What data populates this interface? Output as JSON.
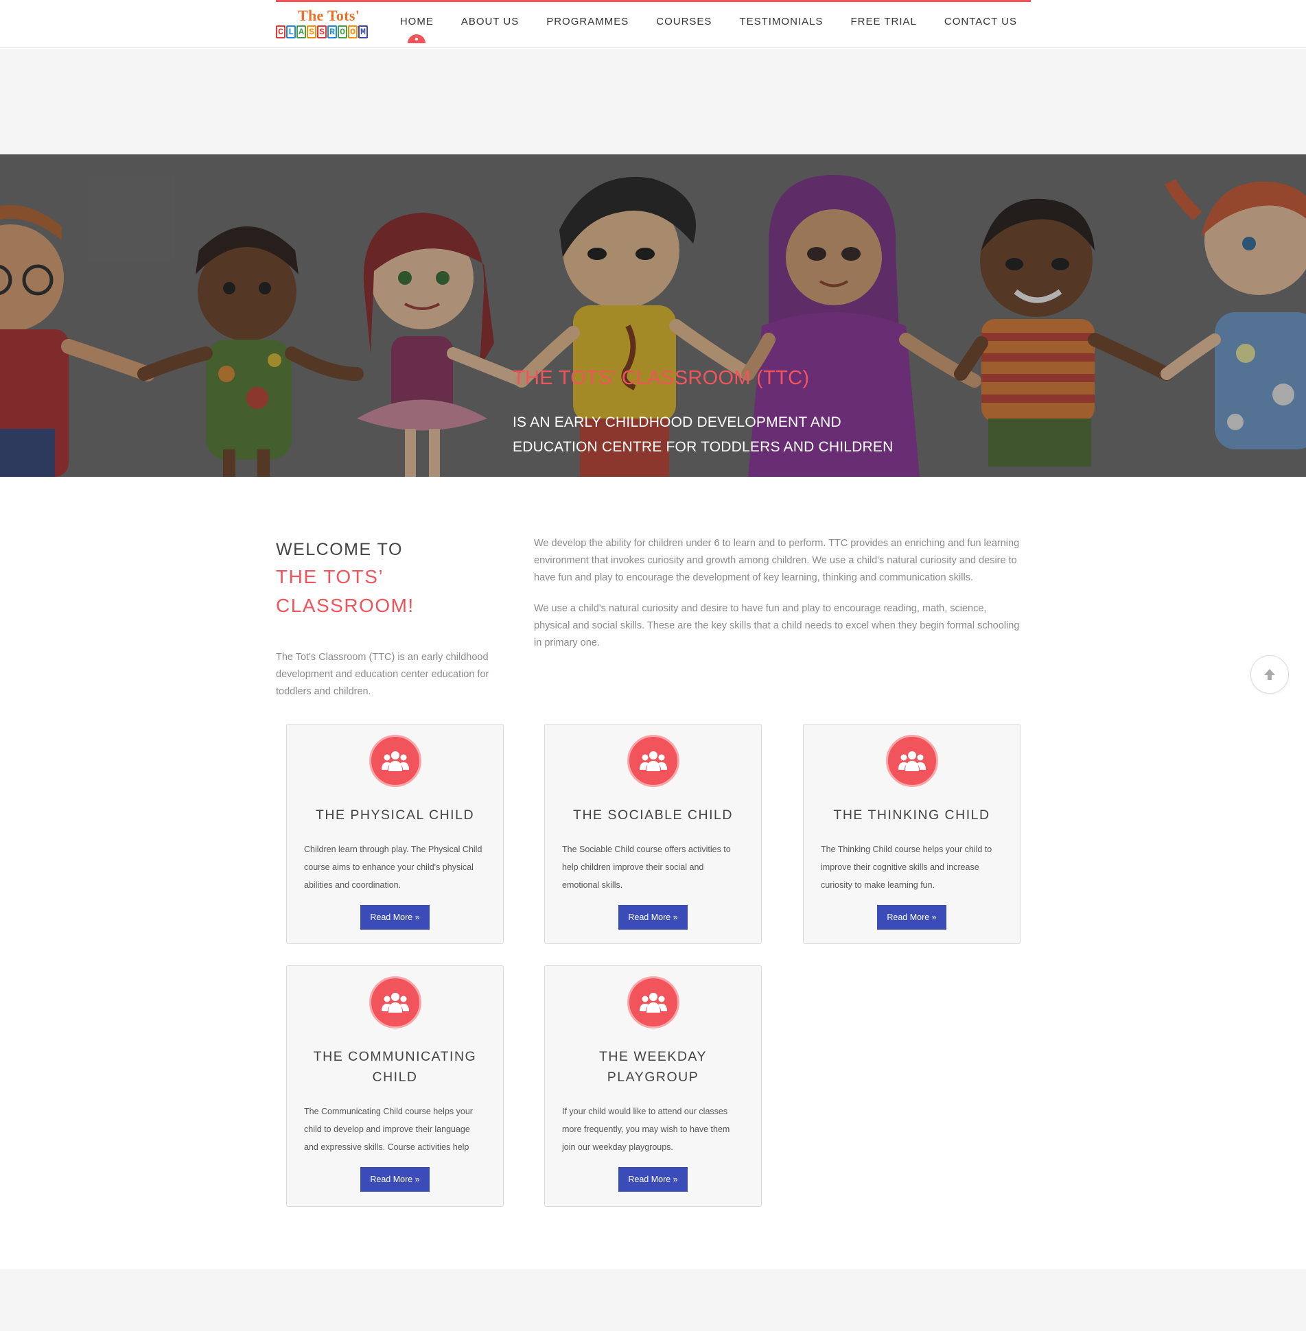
{
  "logo": {
    "title": "The Tots'",
    "blocks": [
      "C",
      "L",
      "A",
      "S",
      "S",
      "R",
      "O",
      "O",
      "M"
    ],
    "block_colors": [
      "#e53935",
      "#1e88e5",
      "#43a047",
      "#fb8c00",
      "#e53935",
      "#1e88e5",
      "#43a047",
      "#fb8c00",
      "#3949ab"
    ]
  },
  "nav": {
    "items": [
      {
        "label": "HOME",
        "active": true
      },
      {
        "label": "ABOUT US"
      },
      {
        "label": "PROGRAMMES"
      },
      {
        "label": "COURSES"
      },
      {
        "label": "TESTIMONIALS"
      },
      {
        "label": "FREE TRIAL"
      },
      {
        "label": "CONTACT US"
      }
    ]
  },
  "hero": {
    "title": "THE TOTS’ CLASSROOM (TTC)",
    "subtitle": "IS AN EARLY CHILDHOOD DEVELOPMENT AND EDUCATION CENTRE FOR TODDLERS AND CHILDREN"
  },
  "welcome": {
    "heading_line1": "WELCOME TO",
    "heading_line2": "THE TOTS’ CLASSROOM!",
    "description": "The Tot's Classroom (TTC) is an early childhood development and education center education for toddlers and children.",
    "paragraph1": "We develop the ability for children under 6 to learn and to perform. TTC provides an enriching and fun learning environment that invokes curiosity and growth among children. We use a child's natural curiosity and desire to have fun and play to encourage the development of key learning, thinking and communication skills.",
    "paragraph2": "We use a child's natural curiosity and desire to have fun and play to encourage reading, math, science, physical and social skills. These are the key skills that a child needs to excel when they begin formal schooling in primary one."
  },
  "cards": [
    {
      "title": "THE PHYSICAL CHILD",
      "text": "Children learn through play. The Physical Child course aims to enhance your child's physical abilities and coordination.",
      "button": "Read More »",
      "icon": "group-icon"
    },
    {
      "title": "THE SOCIABLE CHILD",
      "text": "The Sociable Child course offers activities to help children improve their social and emotional skills.",
      "button": "Read More »",
      "icon": "group-icon"
    },
    {
      "title": "THE THINKING CHILD",
      "text": "The Thinking Child course helps your child to improve their cognitive skills and increase curiosity to make learning fun.",
      "button": "Read More »",
      "icon": "group-icon"
    },
    {
      "title": "THE COMMUNICATING CHILD",
      "text": "The Communicating Child course helps your child to develop and improve their language and expressive skills. Course activities help",
      "button": "Read More »",
      "icon": "group-icon"
    },
    {
      "title": "THE WEEKDAY PLAYGROUP",
      "text": "If your child would like to attend our classes more frequently, you may wish to have them join our weekday playgroups.",
      "button": "Read More »",
      "icon": "group-icon"
    }
  ],
  "colors": {
    "accent": "#f2545b",
    "button": "#3b4cb8"
  },
  "scroll_top_icon": "arrow-up-icon"
}
